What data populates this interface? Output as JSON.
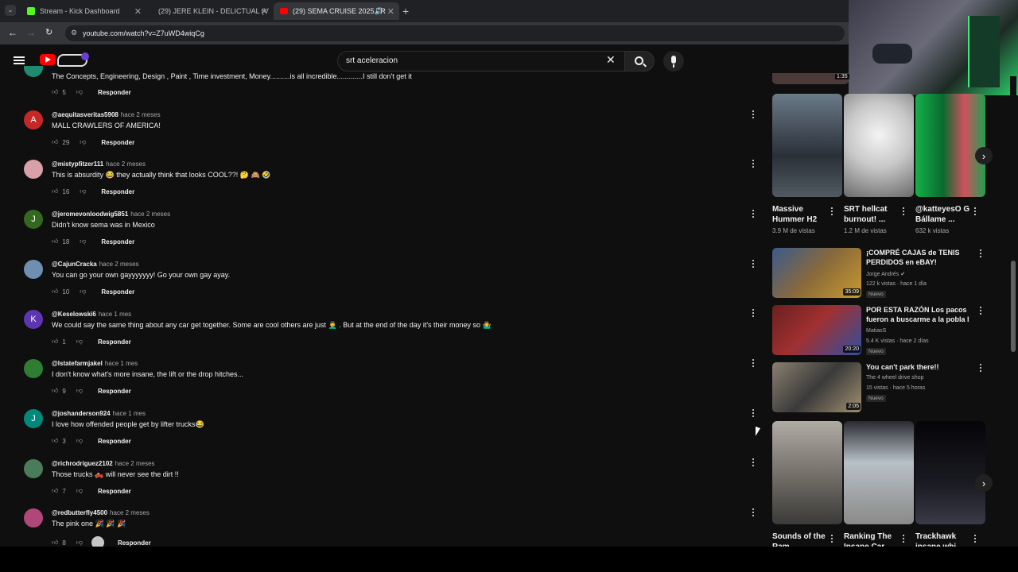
{
  "browser": {
    "tabs": [
      {
        "label": "Stream - Kick Dashboard",
        "icon": "kick-icon"
      },
      {
        "label": "(29) JERE KLEIN - DELICTUAL (V",
        "icon": "youtube-icon"
      },
      {
        "label": "(29) SEMA CRUISE 2025 TR",
        "icon": "youtube-icon"
      }
    ],
    "url": "youtube.com/watch?v=Z7uWD4wiqCg"
  },
  "colors": {
    "accent": "#ff0000",
    "bg": "#0f0f0f",
    "text": "#f1f1f1",
    "muted": "#aaaaaa"
  },
  "search": {
    "value": "srt aceleracion"
  },
  "comments": [
    {
      "user": "",
      "time": "",
      "text": "The Concepts, Engineering, Design , Paint , Time investment, Money..........is all incredible.............I still don't get it",
      "likes": "5",
      "reply": "Responder",
      "avatar_letter": "",
      "avatar_color": "#1f8a70"
    },
    {
      "user": "@aequitasveritas5908",
      "time": "hace 2 meses",
      "text": "MALL CRAWLERS OF AMERICA!",
      "likes": "29",
      "reply": "Responder",
      "avatar_letter": "A",
      "avatar_color": "#c62828"
    },
    {
      "user": "@mistypfitzer111",
      "time": "hace 2 meses",
      "text": "This is absurdity 😂 they actually think that looks COOL??! 🤔 🙈 🤣",
      "likes": "16",
      "reply": "Responder",
      "avatar_letter": "",
      "avatar_color": "#d8a0a8"
    },
    {
      "user": "@jeromevonloodwig5851",
      "time": "hace 2 meses",
      "text": "Didn't know sema was in Mexico",
      "likes": "18",
      "reply": "Responder",
      "avatar_letter": "J",
      "avatar_color": "#33691e"
    },
    {
      "user": "@CajunCracka",
      "time": "hace 2 meses",
      "text": "You can go your own gayyyyyyy! Go your own gay ayay.",
      "likes": "10",
      "reply": "Responder",
      "avatar_letter": "",
      "avatar_color": "#6f8fb0"
    },
    {
      "user": "@Keselowski6",
      "time": "hace 1 mes",
      "text": "We could say the same thing about any car get together. Some are cool others are just 🤦‍♂️ . But at the end of the day it's their money so 🤷‍♂️",
      "likes": "1",
      "reply": "Responder",
      "avatar_letter": "K",
      "avatar_color": "#5e35b1"
    },
    {
      "user": "@lstatefarmjakel",
      "time": "hace 1 mes",
      "text": "I don't know what's more insane, the lift or the drop hitches...",
      "likes": "9",
      "reply": "Responder",
      "avatar_letter": "",
      "avatar_color": "#2e7d32"
    },
    {
      "user": "@joshanderson924",
      "time": "hace 1 mes",
      "text": "I love how offended people get by lifter trucks😂",
      "likes": "3",
      "reply": "Responder",
      "avatar_letter": "J",
      "avatar_color": "#00897b"
    },
    {
      "user": "@richrodriguez2102",
      "time": "hace 2 meses",
      "text": "Those trucks 🛻 will never see the dirt !!",
      "likes": "7",
      "reply": "Responder",
      "avatar_letter": "",
      "avatar_color": "#4a7c59"
    },
    {
      "user": "@redbutterfly4500",
      "time": "hace 2 meses",
      "text": "The pink one 🎉 🎉 🎉",
      "likes": "8",
      "reply": "Responder",
      "avatar_letter": "",
      "avatar_color": "#b0477a"
    }
  ],
  "top_stub": {
    "duration": "1:35"
  },
  "shorts_row1": [
    {
      "title": "Massive Hummer H2",
      "views": "3.9 M de vistas",
      "thumb": "#4a5a6a"
    },
    {
      "title": "SRT hellcat burnout! ...",
      "views": "1.2 M de vistas",
      "thumb": "#cfcfcf"
    },
    {
      "title": "@katteyesO G Bállame ...",
      "views": "632 k vistas",
      "thumb": "#1e9a4e"
    }
  ],
  "videos": [
    {
      "title": "¡COMPRÉ CAJAS de TENIS PERDIDOS en eBAY!",
      "channel": "Jorge Andrés ✔",
      "meta": "122 k vistas · hace 1 día",
      "badge": "Nuevo",
      "duration": "35:09",
      "thumb": "#7a5a3a"
    },
    {
      "title": "POR ESTA RAZÓN Los pacos fueron a buscarme a la pobla l ...",
      "channel": "MatiasS",
      "meta": "5.4 K vistas · hace 2 días",
      "badge": "Nuevo",
      "duration": "20:20",
      "thumb": "#8a2a2a"
    },
    {
      "title": "You can't park there!!",
      "channel": "The 4 wheel drive shop",
      "meta": "15 vistas · hace 5 horas",
      "badge": "Nuevo",
      "duration": "2:05",
      "thumb": "#6a6a5a"
    }
  ],
  "shorts_row2": [
    {
      "title": "Sounds of the Ram",
      "views": "",
      "thumb": "#8a8a80"
    },
    {
      "title": "Ranking The Insane Car",
      "views": "",
      "thumb": "#9aa0a8"
    },
    {
      "title": "Trackhawk insane whi",
      "views": "",
      "thumb": "#1a1a22"
    }
  ]
}
